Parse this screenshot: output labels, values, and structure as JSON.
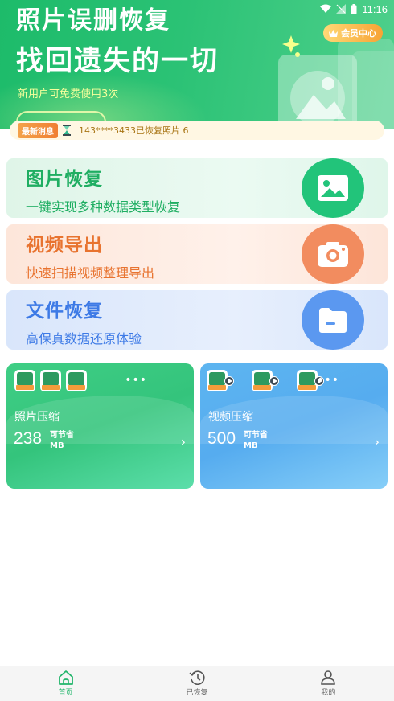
{
  "status": {
    "time": "11:16"
  },
  "hero": {
    "title_line1": "照片误删恢复",
    "title_line2": "找回遗失的一切",
    "subtitle": "新用户可免费使用3次",
    "member_button": "会员中心"
  },
  "ticker": {
    "tag": "最新消息",
    "message": "143****3433已恢复照片 6"
  },
  "features": [
    {
      "title": "图片恢复",
      "subtitle": "一键实现多种数据类型恢复",
      "icon": "image-icon"
    },
    {
      "title": "视频导出",
      "subtitle": "快速扫描视频整理导出",
      "icon": "camera-icon"
    },
    {
      "title": "文件恢复",
      "subtitle": "高保真数据还原体验",
      "icon": "folder-icon"
    }
  ],
  "compress": [
    {
      "title": "照片压缩",
      "amount": "238",
      "save_label": "可节省",
      "unit": "MB"
    },
    {
      "title": "视频压缩",
      "amount": "500",
      "save_label": "可节省",
      "unit": "MB"
    }
  ],
  "nav": [
    {
      "label": "首页",
      "icon": "home-icon",
      "active": true
    },
    {
      "label": "已恢复",
      "icon": "history-icon",
      "active": false
    },
    {
      "label": "我的",
      "icon": "profile-icon",
      "active": false
    }
  ],
  "colors": {
    "primary_green": "#22c47a",
    "video_orange": "#f28c5f",
    "file_blue": "#5b98f0"
  }
}
